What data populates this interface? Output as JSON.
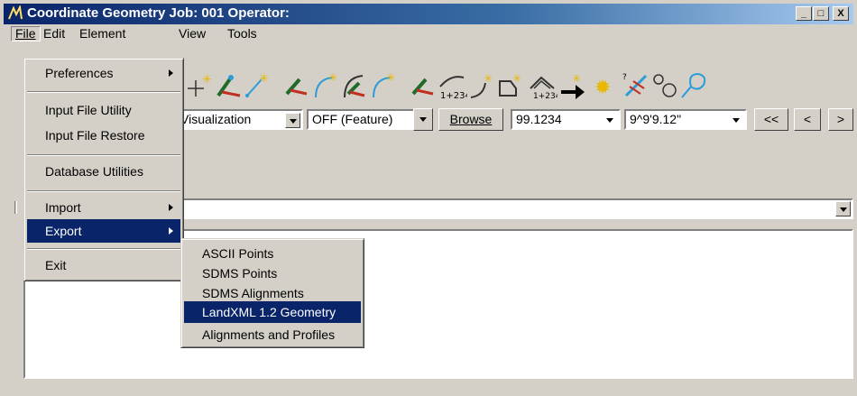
{
  "window": {
    "title": "Coordinate Geometry  Job: 001  Operator:",
    "minimize": "_",
    "maximize": "□",
    "close": "X"
  },
  "menubar": {
    "items": [
      "File",
      "Edit",
      "Element",
      "View",
      "Tools"
    ]
  },
  "file_menu": {
    "items": [
      {
        "label": "Preferences",
        "submenu": true
      },
      {
        "label": "Input File Utility",
        "submenu": false
      },
      {
        "label": "Input File Restore",
        "submenu": false
      },
      {
        "label": "Database Utilities",
        "submenu": false
      },
      {
        "label": "Import",
        "submenu": true
      },
      {
        "label": "Export",
        "submenu": true,
        "selected": true
      },
      {
        "label": "Exit",
        "submenu": false
      }
    ]
  },
  "export_menu": {
    "items": [
      {
        "label": "ASCII Points"
      },
      {
        "label": "SDMS Points"
      },
      {
        "label": "SDMS Alignments"
      },
      {
        "label": "LandXML 1.2 Geometry",
        "selected": true
      },
      {
        "label": "Alignments and Profiles"
      }
    ]
  },
  "toolbar2": {
    "visualization": "Visualization",
    "feature_mode": "OFF (Feature)",
    "browse": "Browse",
    "distance": "99.1234",
    "angle": "9^9'9.12\"",
    "first": "<<",
    "prev": "<",
    "next": ">"
  },
  "tool_label": "1+234",
  "colors": {
    "titlebar": "#0a246a",
    "face": "#d4d0c8",
    "selection": "#0a246a",
    "tool_green": "#1f6b2a",
    "tool_red": "#c03020",
    "tool_yellow": "#f4d000"
  },
  "icons": [
    "point-star-icon",
    "line-point-icon",
    "line-star-icon",
    "arc-point-icon",
    "curve-star-icon",
    "arc-curve-icon",
    "curve-star-icon-2",
    "station-curve-icon",
    "spiral-star-icon",
    "polygon-star-icon",
    "station-hump-icon",
    "arrow-star-icon",
    "sunburst-icon",
    "crossed-line-icon",
    "circles-icon",
    "loop-icon"
  ]
}
